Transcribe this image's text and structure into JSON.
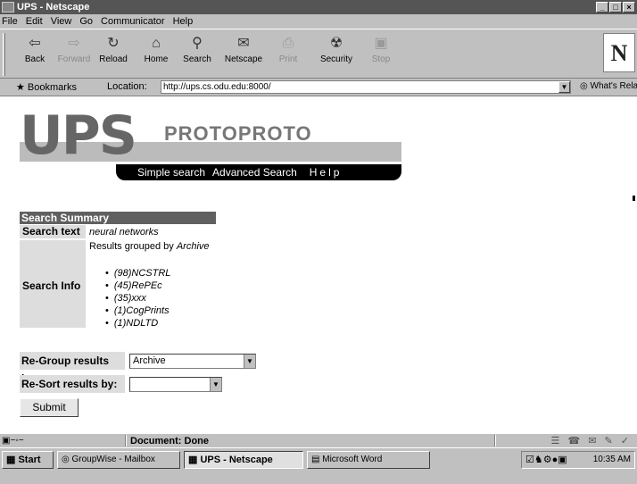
{
  "window": {
    "title": "UPS - Netscape",
    "buttons": [
      "_",
      "□",
      "×"
    ]
  },
  "menu": [
    "File",
    "Edit",
    "View",
    "Go",
    "Communicator",
    "Help"
  ],
  "toolbar": {
    "back": "Back",
    "forward": "Forward",
    "reload": "Reload",
    "home": "Home",
    "search": "Search",
    "netscape": "Netscape",
    "print": "Print",
    "security": "Security",
    "stop": "Stop",
    "brand": "N"
  },
  "location": {
    "bookmarks": "Bookmarks",
    "label": "Location:",
    "url": "http://ups.cs.odu.edu:8000/",
    "related": "What's Related"
  },
  "page": {
    "logo_letters": "UPS",
    "logo_sub": "PROTOPROTO",
    "nav": {
      "simple": "Simple search",
      "advanced": "Advanced Search",
      "help": "Help"
    },
    "summary": {
      "header": "Search Summary",
      "search_text_label": "Search text",
      "search_text_value": "neural networks",
      "search_info_label": "Search Info",
      "grouped_prefix": "Results grouped by",
      "grouped_by": "Archive",
      "groups": [
        "(98)NCSTRL",
        "(45)RePEc",
        "(35)xxx",
        "(1)CogPrints",
        "(1)NDLTD"
      ]
    },
    "regroup": {
      "label": "Re-Group results by:",
      "value": "Archive"
    },
    "resort": {
      "label": "Re-Sort results by:",
      "value": ""
    },
    "submit": "Submit"
  },
  "status": {
    "text": "Document: Done"
  },
  "taskbar": {
    "start": "Start",
    "items": [
      "GroupWise - Mailbox",
      "UPS - Netscape",
      "Microsoft Word"
    ],
    "clock": "10:35 AM"
  }
}
